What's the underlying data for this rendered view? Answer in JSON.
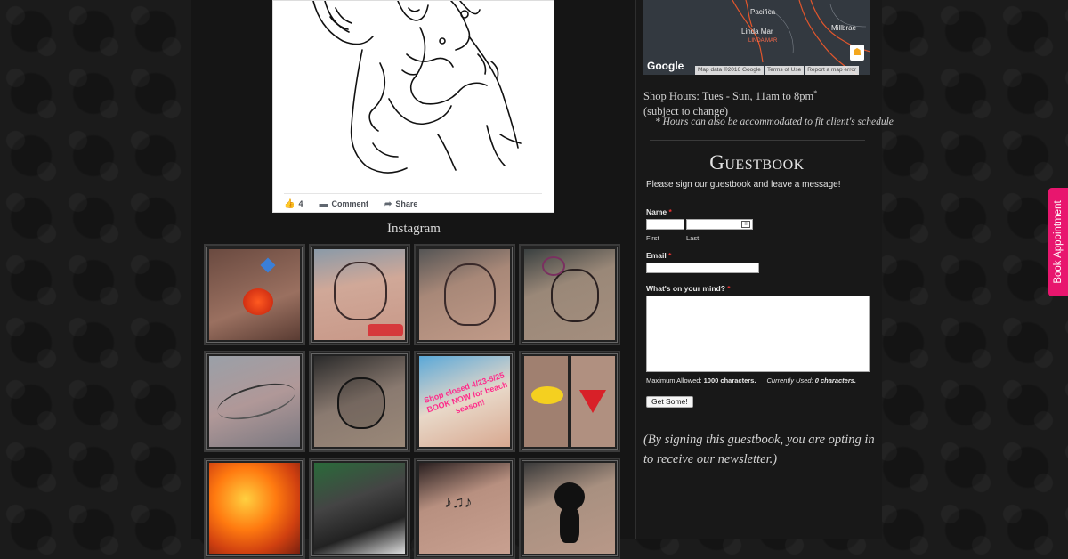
{
  "facebook_post": {
    "like_count": "4",
    "comment_label": "Comment",
    "share_label": "Share"
  },
  "instagram": {
    "title": "Instagram",
    "tiles": [
      {
        "label": "rose-and-butterfly-tattoo"
      },
      {
        "label": "sugar-skull-foot-tattoo"
      },
      {
        "label": "sugar-skull-outline-tattoo"
      },
      {
        "label": "skull-roses-shoulder-tattoo"
      },
      {
        "label": "feather-wing-tattoo"
      },
      {
        "label": "skull-flowers-tattoo"
      },
      {
        "label": "shop-closed-notice",
        "overlay_text": "Shop closed 4/23-5/25 BOOK NOW for beach season!"
      },
      {
        "label": "batman-superman-tattoos"
      },
      {
        "label": "abstract-art-piece"
      },
      {
        "label": "mural-art"
      },
      {
        "label": "music-notes-key-tattoo"
      },
      {
        "label": "felix-cat-tattoo"
      }
    ]
  },
  "map": {
    "labels": [
      "Pacifica",
      "Linda Mar",
      "LINDA MAR",
      "Millbrae"
    ],
    "google": "Google",
    "footer": [
      "Map data ©2016 Google",
      "Terms of Use",
      "Report a map error"
    ]
  },
  "hours": {
    "line1": "Shop Hours: Tues - Sun, 11am to 8pm",
    "asterisk": "*",
    "line2": "(subject to change)",
    "note": "* Hours can also be accommodated to fit client's schedule"
  },
  "guestbook": {
    "title": "Guestbook",
    "intro": "Please sign our guestbook and leave a message!",
    "name_label": "Name",
    "required_mark": "*",
    "first_label": "First",
    "last_label": "Last",
    "email_label": "Email",
    "message_label": "What's on your mind?",
    "max_label": "Maximum Allowed:",
    "max_value": "1000 characters.",
    "used_label": "Currently Used:",
    "used_value": "0 characters.",
    "submit_label": "Get Some!",
    "optin": "(By signing this guestbook, you are opting in to receive our newsletter.)"
  },
  "book_appointment": "Book Appointment",
  "colors": {
    "accent": "#e8166e",
    "background": "#1b1b1b"
  }
}
